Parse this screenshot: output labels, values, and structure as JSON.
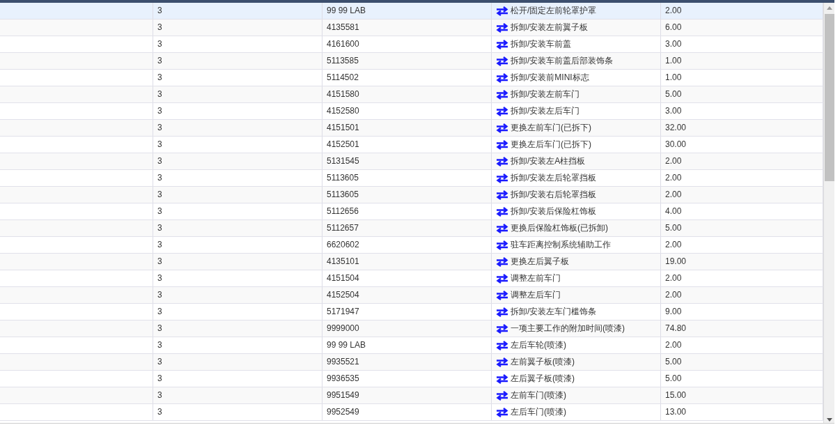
{
  "table": {
    "rows": [
      {
        "selected": true,
        "qty": "3",
        "code": "99 99 LAB",
        "description": "松开/固定左前轮罩护罩",
        "hours": "2.00"
      },
      {
        "selected": false,
        "qty": "3",
        "code": "4135581",
        "description": "拆卸/安装左前翼子板",
        "hours": "6.00"
      },
      {
        "selected": false,
        "qty": "3",
        "code": "4161600",
        "description": "拆卸/安装车前盖",
        "hours": "3.00"
      },
      {
        "selected": false,
        "qty": "3",
        "code": "5113585",
        "description": "拆卸/安装车前盖后部装饰条",
        "hours": "1.00"
      },
      {
        "selected": false,
        "qty": "3",
        "code": "5114502",
        "description": "拆卸/安装前MINI标志",
        "hours": "1.00"
      },
      {
        "selected": false,
        "qty": "3",
        "code": "4151580",
        "description": "拆卸/安装左前车门",
        "hours": "5.00"
      },
      {
        "selected": false,
        "qty": "3",
        "code": "4152580",
        "description": "拆卸/安装左后车门",
        "hours": "3.00"
      },
      {
        "selected": false,
        "qty": "3",
        "code": "4151501",
        "description": "更换左前车门(已拆下)",
        "hours": "32.00"
      },
      {
        "selected": false,
        "qty": "3",
        "code": "4152501",
        "description": "更换左后车门(已拆下)",
        "hours": "30.00"
      },
      {
        "selected": false,
        "qty": "3",
        "code": "5131545",
        "description": "拆卸/安装左A柱挡板",
        "hours": "2.00"
      },
      {
        "selected": false,
        "qty": "3",
        "code": "5113605",
        "description": "拆卸/安装左后轮罩挡板",
        "hours": "2.00"
      },
      {
        "selected": false,
        "qty": "3",
        "code": "5113605",
        "description": "拆卸/安装右后轮罩挡板",
        "hours": "2.00"
      },
      {
        "selected": false,
        "qty": "3",
        "code": "5112656",
        "description": "拆卸/安装后保险杠饰板",
        "hours": "4.00"
      },
      {
        "selected": false,
        "qty": "3",
        "code": "5112657",
        "description": "更换后保险杠饰板(已拆卸)",
        "hours": "5.00"
      },
      {
        "selected": false,
        "qty": "3",
        "code": "6620602",
        "description": "驻车距离控制系统辅助工作",
        "hours": "2.00"
      },
      {
        "selected": false,
        "qty": "3",
        "code": "4135101",
        "description": "更换左后翼子板",
        "hours": "19.00"
      },
      {
        "selected": false,
        "qty": "3",
        "code": "4151504",
        "description": "调整左前车门",
        "hours": "2.00"
      },
      {
        "selected": false,
        "qty": "3",
        "code": "4152504",
        "description": "调整左后车门",
        "hours": "2.00"
      },
      {
        "selected": false,
        "qty": "3",
        "code": "5171947",
        "description": "拆卸/安装左车门槛饰条",
        "hours": "9.00"
      },
      {
        "selected": false,
        "qty": "3",
        "code": "9999000",
        "description": "一项主要工作的附加时间(喷漆)",
        "hours": "74.80"
      },
      {
        "selected": false,
        "qty": "3",
        "code": "99 99 LAB",
        "description": "左后车轮(喷漆)",
        "hours": "2.00"
      },
      {
        "selected": false,
        "qty": "3",
        "code": "9935521",
        "description": "左前翼子板(喷漆)",
        "hours": "5.00"
      },
      {
        "selected": false,
        "qty": "3",
        "code": "9936535",
        "description": "左后翼子板(喷漆)",
        "hours": "5.00"
      },
      {
        "selected": false,
        "qty": "3",
        "code": "9951549",
        "description": "左前车门(喷漆)",
        "hours": "15.00"
      },
      {
        "selected": false,
        "qty": "3",
        "code": "9952549",
        "description": "左后车门(喷漆)",
        "hours": "13.00"
      }
    ]
  }
}
